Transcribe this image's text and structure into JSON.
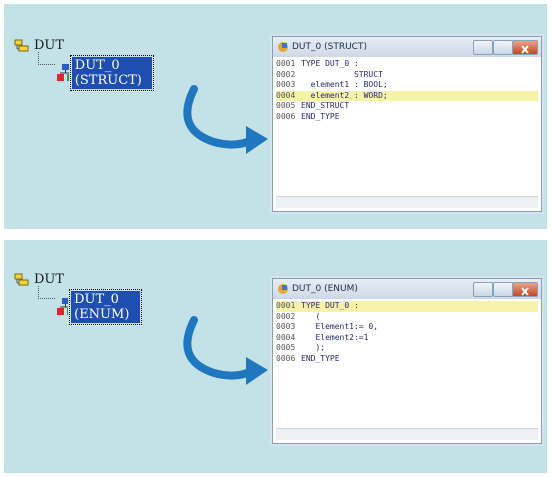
{
  "top": {
    "tree": {
      "root_label": "DUT",
      "child_label": "DUT_0 (STRUCT)"
    },
    "window": {
      "title": "DUT_0 (STRUCT)",
      "lines": [
        {
          "no": "0001",
          "code": "TYPE DUT_0 :"
        },
        {
          "no": "0002",
          "code": "           STRUCT"
        },
        {
          "no": "0003",
          "code": "  element1 : BOOL;"
        },
        {
          "no": "0004",
          "code": "  element2 : WORD;"
        },
        {
          "no": "0005",
          "code": "END_STRUCT"
        },
        {
          "no": "0006",
          "code": "END_TYPE"
        }
      ]
    }
  },
  "bottom": {
    "tree": {
      "root_label": "DUT",
      "child_label": "DUT_0 (ENUM)"
    },
    "window": {
      "title": "DUT_0 (ENUM)",
      "lines": [
        {
          "no": "0001",
          "code": "TYPE DUT_0 :"
        },
        {
          "no": "0002",
          "code": "   ("
        },
        {
          "no": "0003",
          "code": "   Element1:= 0,"
        },
        {
          "no": "0004",
          "code": "   Element2:=1"
        },
        {
          "no": "0005",
          "code": "   );"
        },
        {
          "no": "0006",
          "code": "END_TYPE"
        }
      ]
    }
  },
  "colors": {
    "panel": "#c3e2e7",
    "selection": "#1e4fb0",
    "highlight": "#f6f3a8",
    "arrow": "#1f78bf"
  }
}
